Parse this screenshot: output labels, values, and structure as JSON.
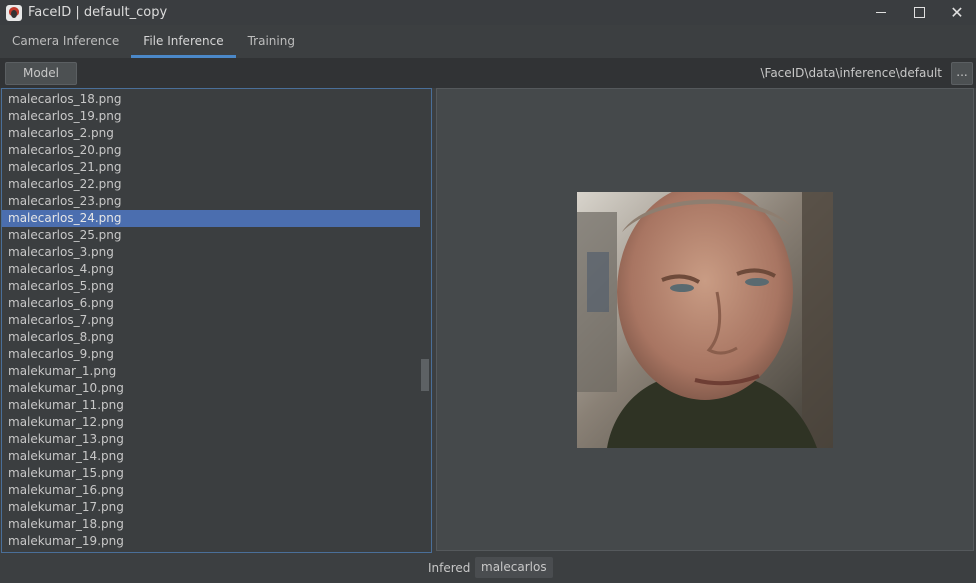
{
  "window": {
    "title": "FaceID | default_copy",
    "icon": "faceid-app-icon",
    "controls": {
      "minimize": "minimize-icon",
      "maximize": "maximize-icon",
      "close": "close-icon",
      "close_glyph": "✕"
    }
  },
  "tabs": [
    {
      "label": "Camera Inference",
      "active": false
    },
    {
      "label": "File Inference",
      "active": true
    },
    {
      "label": "Training",
      "active": false
    }
  ],
  "toolbar": {
    "model_button": "Model",
    "path": "\\FaceID\\data\\inference\\default",
    "browse_button": "..."
  },
  "file_list": {
    "selected": "malecarlos_24.png",
    "items": [
      "malecarlos_18.png",
      "malecarlos_19.png",
      "malecarlos_2.png",
      "malecarlos_20.png",
      "malecarlos_21.png",
      "malecarlos_22.png",
      "malecarlos_23.png",
      "malecarlos_24.png",
      "malecarlos_25.png",
      "malecarlos_3.png",
      "malecarlos_4.png",
      "malecarlos_5.png",
      "malecarlos_6.png",
      "malecarlos_7.png",
      "malecarlos_8.png",
      "malecarlos_9.png",
      "malekumar_1.png",
      "malekumar_10.png",
      "malekumar_11.png",
      "malekumar_12.png",
      "malekumar_13.png",
      "malekumar_14.png",
      "malekumar_15.png",
      "malekumar_16.png",
      "malekumar_17.png",
      "malekumar_18.png",
      "malekumar_19.png"
    ]
  },
  "status": {
    "label": "Infered",
    "value": "malecarlos"
  },
  "colors": {
    "accent": "#4b88c8",
    "selection": "#4b6eaf",
    "background": "#3c3f41"
  }
}
